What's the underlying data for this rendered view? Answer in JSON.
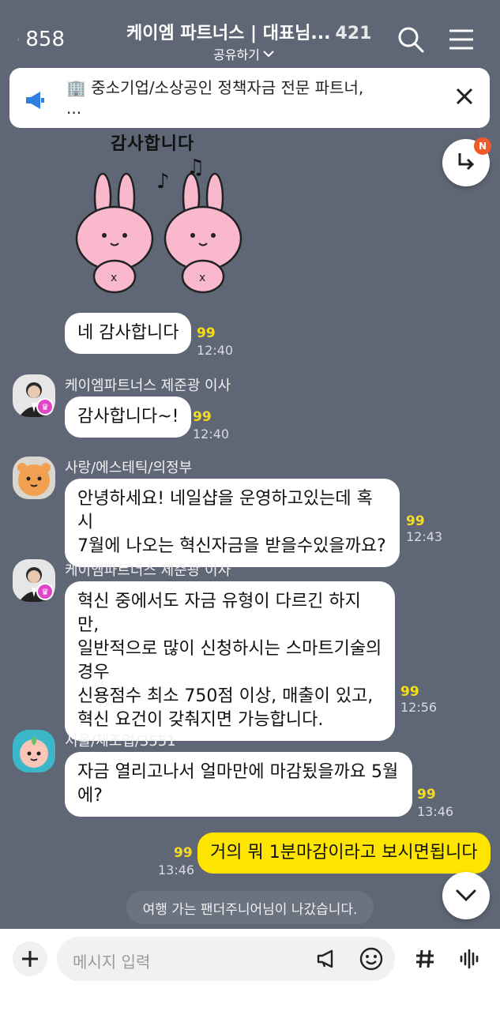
{
  "header": {
    "back_count": "858",
    "title": "케이엠 파트너스 | 대표님...",
    "member_count": "421",
    "share_label": "공유하기"
  },
  "notice": {
    "text_line1": "🏢 중소기업/소상공인 정책자금 전문 파트너,",
    "text_line2": "..."
  },
  "fab": {
    "badge": "N"
  },
  "sticker": {
    "caption": "감사합니다"
  },
  "messages": [
    {
      "text": "네 감사합니다",
      "unread": "99",
      "time": "12:40"
    },
    {
      "sender": "케이엠파트너스 제준광 이사",
      "text": "감사합니다~!",
      "unread": "99",
      "time": "12:40"
    },
    {
      "sender": "사랑/에스테틱/의정부",
      "line1": "안녕하세요! 네일샵을 운영하고있는데 혹시",
      "line2": "7월에 나오는 혁신자금을 받을수있을까요?",
      "unread": "99",
      "time": "12:43"
    },
    {
      "sender": "케이엠파트너스 제준광 이사",
      "line1": "혁신 중에서도 자금 유형이 다르긴 하지만,",
      "line2": "일반적으로 많이 신청하시는 스마트기술의",
      "line3": "경우",
      "line4": "신용점수 최소 750점 이상, 매출이 있고,",
      "line5": "혁신 요건이 갖춰지면 가능합니다.",
      "unread": "99",
      "time": "12:56"
    },
    {
      "sender": "서울/제조업/3551",
      "line1": "자금 열리고나서 얼마만에 마감됬을까요 5월",
      "line2": "에?",
      "unread": "99",
      "time": "13:46"
    },
    {
      "text": "거의 뭐 1분마감이라고 보시면됩니다",
      "unread": "99",
      "time": "13:46"
    }
  ],
  "system_message": "여행 가는 팬더주니어님이 나갔습니다.",
  "input": {
    "placeholder": "메시지 입력"
  },
  "colors": {
    "background": "#5f6675",
    "my_bubble": "#fde500",
    "unread": "#f6dd1b",
    "crown": "#e045c8"
  }
}
